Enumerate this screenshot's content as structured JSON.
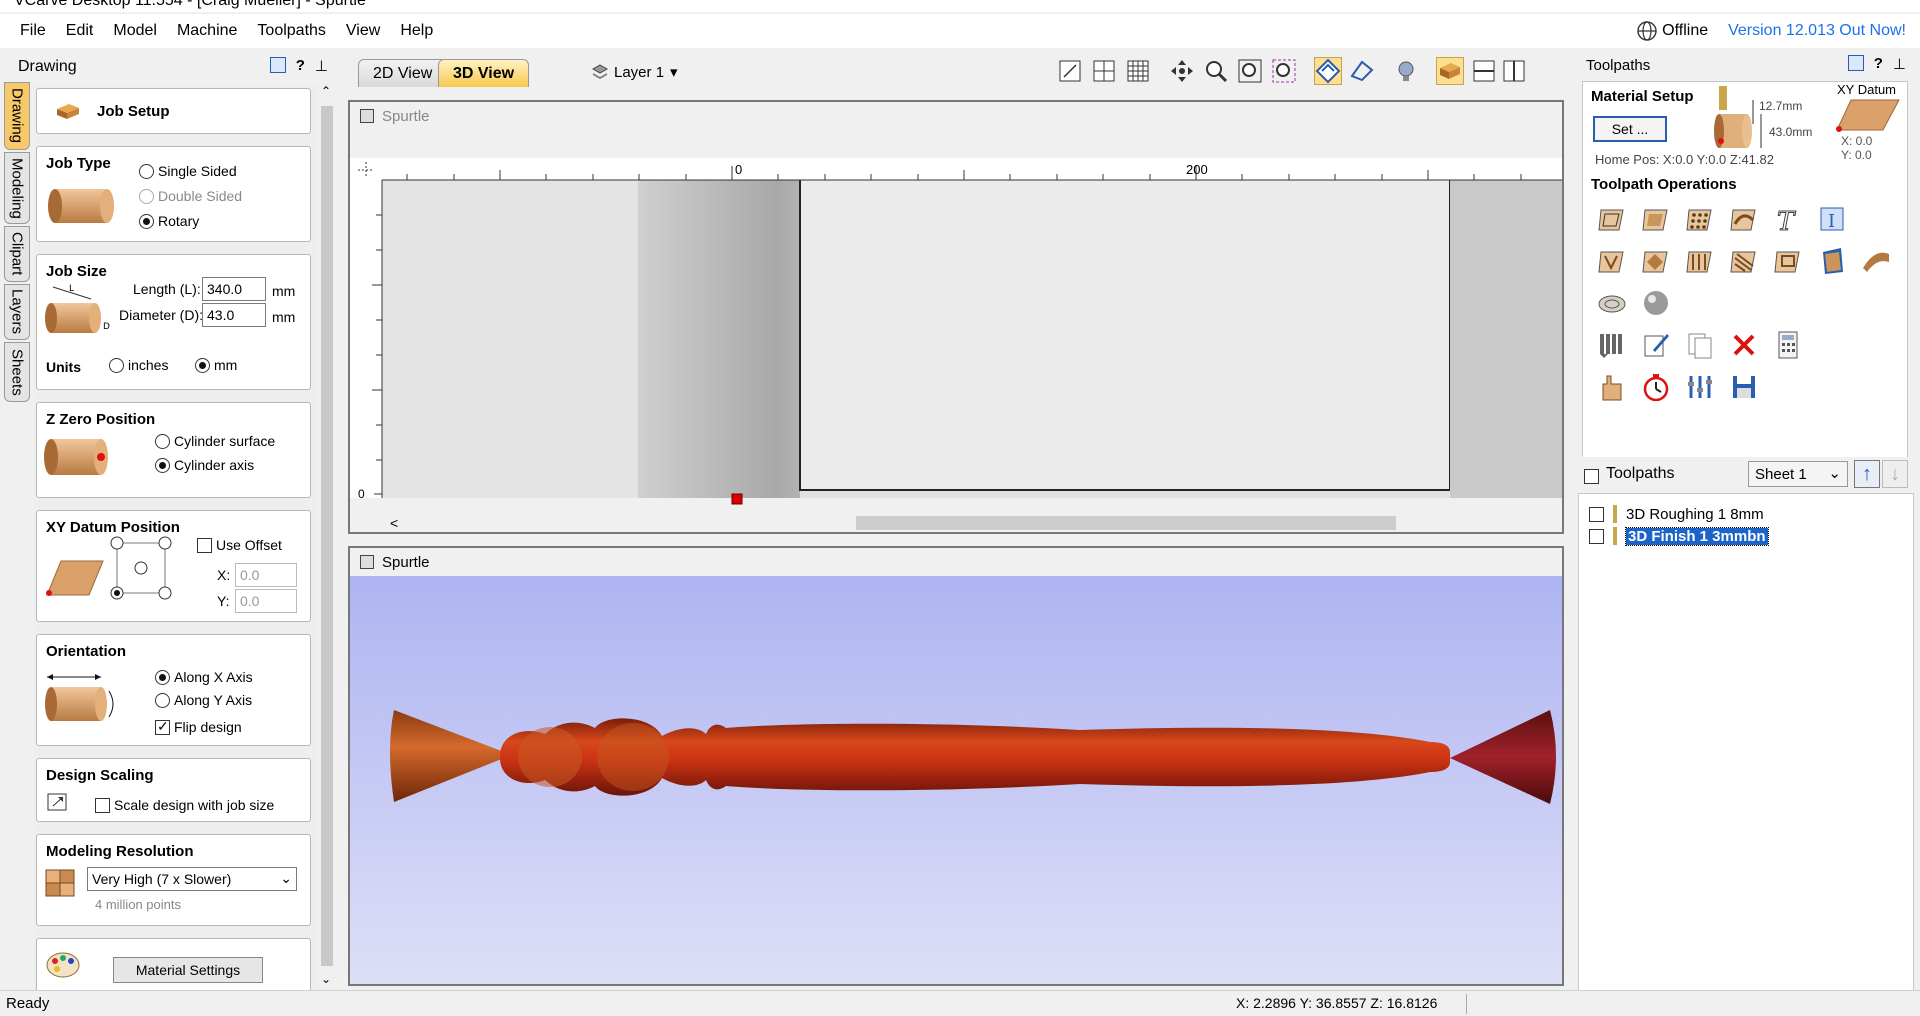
{
  "window_title": "VCarve Desktop 11.554 - [Craig Mueller] - Spurtle",
  "menu": [
    "File",
    "Edit",
    "Model",
    "Machine",
    "Toolpaths",
    "View",
    "Help"
  ],
  "header_right": {
    "offline_label": "Offline",
    "update_label": "Version 12.013 Out Now!"
  },
  "left_panel": {
    "title": "Drawing",
    "vtabs": [
      "Drawing",
      "Modeling",
      "Clipart",
      "Layers",
      "Sheets"
    ],
    "job_setup": "Job Setup",
    "job_type": {
      "title": "Job Type",
      "options": [
        "Single Sided",
        "Double Sided",
        "Rotary"
      ],
      "selected": "Rotary"
    },
    "job_size": {
      "title": "Job Size",
      "length_label": "Length (L):",
      "length_value": "340.0",
      "diameter_label": "Diameter (D):",
      "diameter_value": "43.0",
      "unit": "mm",
      "units_label": "Units",
      "units_inches": "inches",
      "units_mm": "mm",
      "units_selected": "mm"
    },
    "z_zero": {
      "title": "Z Zero Position",
      "opt1": "Cylinder surface",
      "opt2": "Cylinder axis",
      "selected": "Cylinder axis"
    },
    "xy_datum": {
      "title": "XY Datum Position",
      "use_offset": "Use Offset",
      "x_label": "X:",
      "x_value": "0.0",
      "y_label": "Y:",
      "y_value": "0.0"
    },
    "orientation": {
      "title": "Orientation",
      "opt1": "Along X Axis",
      "opt2": "Along Y Axis",
      "selected": "Along X Axis",
      "flip": "Flip design",
      "flip_checked": true
    },
    "design_scaling": {
      "title": "Design Scaling",
      "scale_label": "Scale design with job size",
      "checked": false
    },
    "modeling_resolution": {
      "title": "Modeling Resolution",
      "selected": "Very High (7 x Slower)",
      "hint": "4 million points"
    },
    "material_settings": "Material Settings"
  },
  "view_tabs": [
    "2D View",
    "3D View"
  ],
  "active_view": "3D View",
  "layer": "Layer 1",
  "view2d": {
    "title": "Spurtle",
    "ruler_labels": [
      "0",
      "200"
    ],
    "vruler_label": "0"
  },
  "view3d": {
    "title": "Spurtle"
  },
  "right_panel": {
    "title": "Toolpaths",
    "material_setup": "Material Setup",
    "set_button": "Set ...",
    "dim_top": "12.7mm",
    "dim_bottom": "43.0mm",
    "home_pos": "Home Pos:  X:0.0 Y:0.0 Z:41.82",
    "xy_datum_label": "XY Datum",
    "xy_x": "X: 0.0",
    "xy_y": "Y: 0.0",
    "operations_title": "Toolpath Operations",
    "toolpaths_header": "Toolpaths",
    "sheet": "Sheet 1",
    "toolpaths": [
      {
        "name": "3D Roughing 1  8mm",
        "selected": false
      },
      {
        "name": "3D Finish 1 3mmbn",
        "selected": true
      }
    ]
  },
  "status": {
    "left": "Ready",
    "coords": "X:  2.2896 Y: 36.8557 Z: 16.8126"
  }
}
